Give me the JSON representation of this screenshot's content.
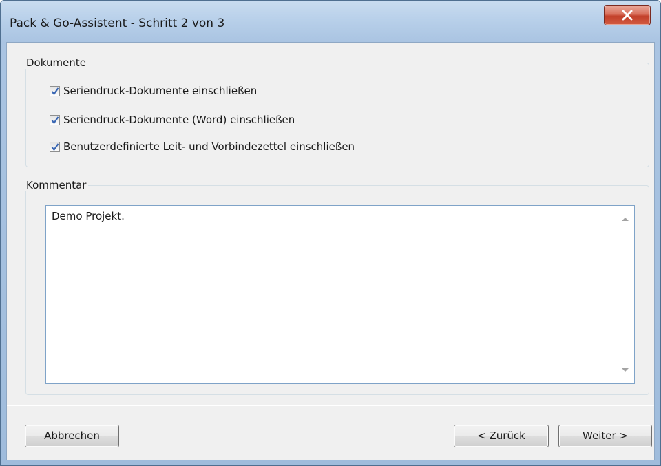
{
  "window": {
    "title": "Pack & Go-Assistent - Schritt 2 von 3",
    "close_icon": "close-icon"
  },
  "documents_group": {
    "legend": "Dokumente",
    "options": [
      {
        "label": "Seriendruck-Dokumente einschließen",
        "checked": true
      },
      {
        "label": "Seriendruck-Dokumente (Word) einschließen",
        "checked": true
      },
      {
        "label": "Benutzerdefinierte Leit- und Vorbindezettel einschließen",
        "checked": true
      }
    ]
  },
  "comment_group": {
    "legend": "Kommentar",
    "value": "Demo Projekt."
  },
  "buttons": {
    "cancel": "Abbrechen",
    "back": "< Zurück",
    "next": "Weiter >"
  },
  "colors": {
    "checkmark": "#3b68b4",
    "close_button": "#c2402a"
  }
}
